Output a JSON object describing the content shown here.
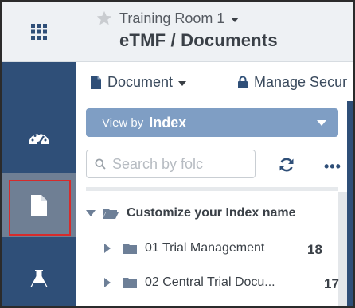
{
  "header": {
    "room_name": "Training Room 1",
    "page_title": "eTMF / Documents",
    "icons": [
      "app-grid-icon",
      "star-icon",
      "caret-down-icon"
    ]
  },
  "sidenav": {
    "items": [
      {
        "icon": "dashboard-icon",
        "selected": false
      },
      {
        "icon": "document-icon",
        "selected": true
      },
      {
        "icon": "flask-icon",
        "selected": false
      }
    ]
  },
  "toolbar": {
    "document_label": "Document",
    "manage_label": "Manage Secur"
  },
  "viewby": {
    "prefix": "View by",
    "value": "Index"
  },
  "search": {
    "placeholder": "Search by folc"
  },
  "tree": {
    "root_label": "Customize your Index name",
    "items": [
      {
        "label": "01 Trial Management",
        "count": "18"
      },
      {
        "label": "02 Central Trial Docu...",
        "count": "17"
      }
    ]
  },
  "colors": {
    "nav_bg": "#2f4f78",
    "nav_selected": "#6f7f94",
    "highlight_border": "#d62b2b",
    "viewby_bg": "#7f9ec4",
    "header_bg": "#eef1f4"
  }
}
